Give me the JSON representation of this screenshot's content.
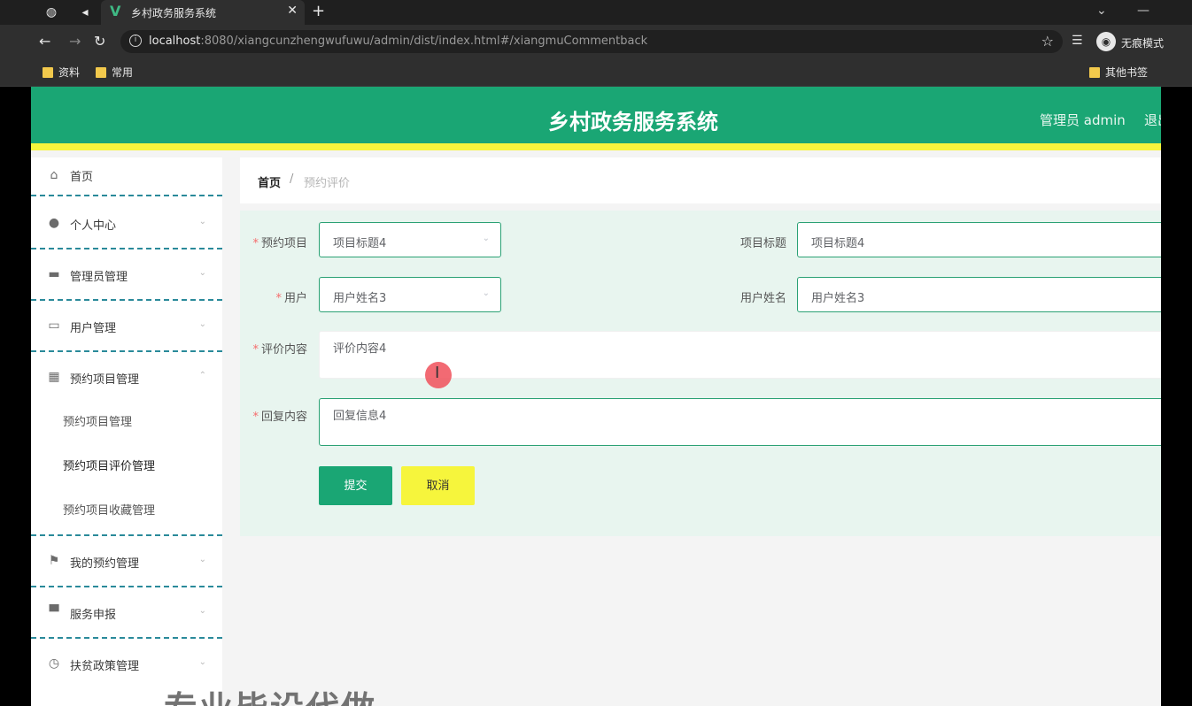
{
  "browser": {
    "tab_title": "乡村政务服务系统",
    "url_host": "localhost",
    "url_rest": ":8080/xiangcunzhengwufuwu/admin/dist/index.html#/xiangmuCommentback",
    "incognito_label": "无痕模式",
    "bookmarks": [
      "资料",
      "常用"
    ],
    "other_bookmarks": "其他书签"
  },
  "header": {
    "title": "乡村政务服务系统",
    "user": "管理员 admin",
    "logout": "退出"
  },
  "sidebar": {
    "items": [
      {
        "label": "首页",
        "icon": "home-icon"
      },
      {
        "label": "个人中心",
        "icon": "user-icon"
      },
      {
        "label": "管理员管理",
        "icon": "admin-icon"
      },
      {
        "label": "用户管理",
        "icon": "users-icon"
      },
      {
        "label": "预约项目管理",
        "icon": "grid-icon"
      },
      {
        "label": "我的预约管理",
        "icon": "flag-icon"
      },
      {
        "label": "服务申报",
        "icon": "message-icon"
      },
      {
        "label": "扶贫政策管理",
        "icon": "clock-icon"
      }
    ],
    "subitems": [
      "预约项目管理",
      "预约项目评价管理",
      "预约项目收藏管理"
    ]
  },
  "breadcrumb": {
    "home": "首页",
    "separator": "/",
    "current": "预约评价"
  },
  "form": {
    "project_label": "预约项目",
    "project_value": "项目标题4",
    "title_label": "项目标题",
    "title_value": "项目标题4",
    "user_label": "用户",
    "user_value": "用户姓名3",
    "username_label": "用户姓名",
    "username_value": "用户姓名3",
    "comment_label": "评价内容",
    "comment_value": "评价内容4",
    "reply_label": "回复内容",
    "reply_value": "回复信息4",
    "submit": "提交",
    "cancel": "取消"
  },
  "watermark": "专业毕设代做",
  "colors": {
    "primary": "#1aa674",
    "accent": "#f6f53c",
    "form_bg": "#e8f5ef"
  }
}
